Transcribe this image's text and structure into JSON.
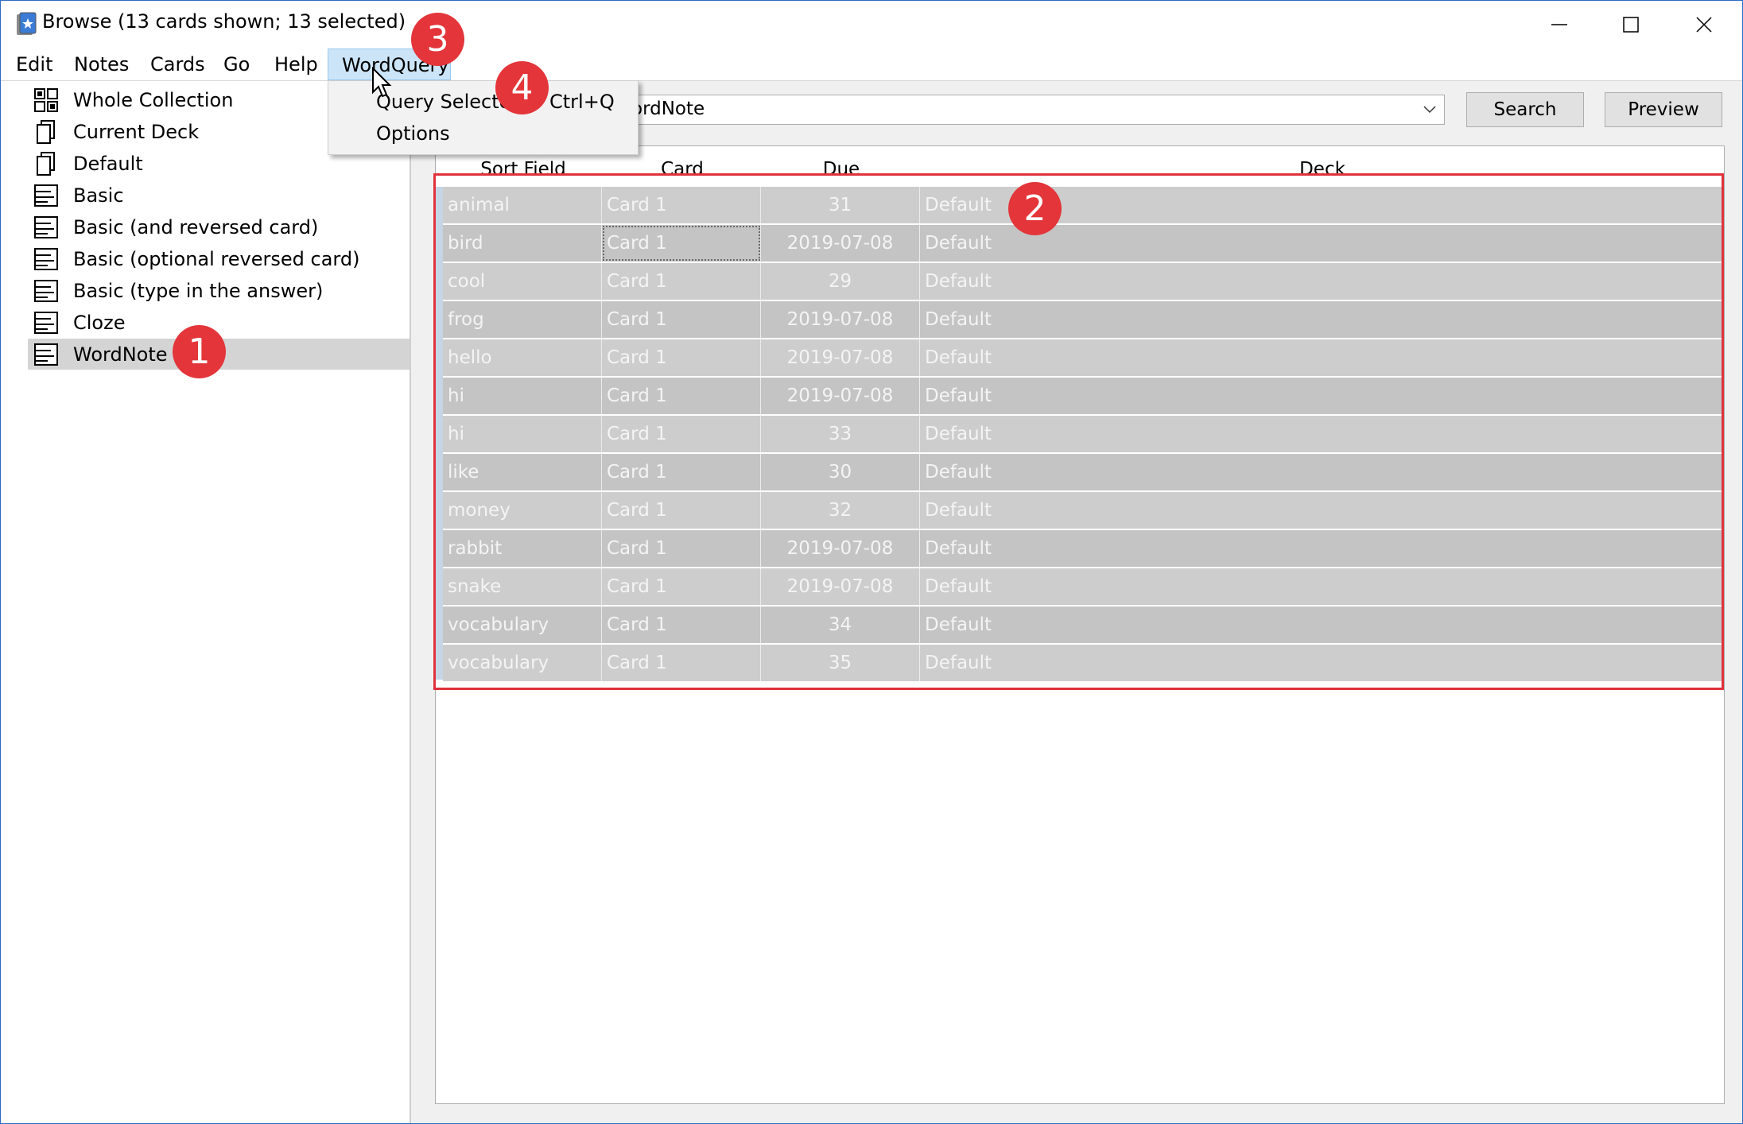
{
  "window": {
    "title": "Browse (13 cards shown; 13 selected)",
    "controls": {
      "minimize": "─",
      "maximize": "☐",
      "close": "✕"
    }
  },
  "menubar": {
    "items": [
      "Edit",
      "Notes",
      "Cards",
      "Go",
      "Help",
      "WordQuery"
    ],
    "open_menu": "WordQuery"
  },
  "wordquery_menu": {
    "items": [
      {
        "label": "Query Selected",
        "shortcut": "Ctrl+Q"
      },
      {
        "label": "Options",
        "shortcut": ""
      }
    ]
  },
  "sidebar": {
    "items": [
      {
        "label": "Whole Collection",
        "icon": "collection-icon"
      },
      {
        "label": "Current Deck",
        "icon": "deck-icon"
      },
      {
        "label": "Default",
        "icon": "deck-icon"
      },
      {
        "label": "Basic",
        "icon": "note-type-icon"
      },
      {
        "label": "Basic (and reversed card)",
        "icon": "note-type-icon"
      },
      {
        "label": "Basic (optional reversed card)",
        "icon": "note-type-icon"
      },
      {
        "label": "Basic (type in the answer)",
        "icon": "note-type-icon"
      },
      {
        "label": "Cloze",
        "icon": "note-type-icon"
      },
      {
        "label": "WordNote",
        "icon": "note-type-icon"
      }
    ],
    "selected": "WordNote"
  },
  "search": {
    "value": "ordNote",
    "search_button": "Search",
    "preview_button": "Preview"
  },
  "table": {
    "columns": [
      "Sort Field",
      "Card",
      "Due",
      "Deck"
    ],
    "rows": [
      [
        "animal",
        "Card 1",
        "31",
        "Default"
      ],
      [
        "bird",
        "Card 1",
        "2019-07-08",
        "Default"
      ],
      [
        "cool",
        "Card 1",
        "29",
        "Default"
      ],
      [
        "frog",
        "Card 1",
        "2019-07-08",
        "Default"
      ],
      [
        "hello",
        "Card 1",
        "2019-07-08",
        "Default"
      ],
      [
        "hi",
        "Card 1",
        "2019-07-08",
        "Default"
      ],
      [
        "hi",
        "Card 1",
        "33",
        "Default"
      ],
      [
        "like",
        "Card 1",
        "30",
        "Default"
      ],
      [
        "money",
        "Card 1",
        "32",
        "Default"
      ],
      [
        "rabbit",
        "Card 1",
        "2019-07-08",
        "Default"
      ],
      [
        "snake",
        "Card 1",
        "2019-07-08",
        "Default"
      ],
      [
        "vocabulary",
        "Card 1",
        "34",
        "Default"
      ],
      [
        "vocabulary",
        "Card 1",
        "35",
        "Default"
      ]
    ]
  },
  "annotations": {
    "badges": [
      "1",
      "2",
      "3",
      "4"
    ],
    "color": "#e3353a"
  }
}
